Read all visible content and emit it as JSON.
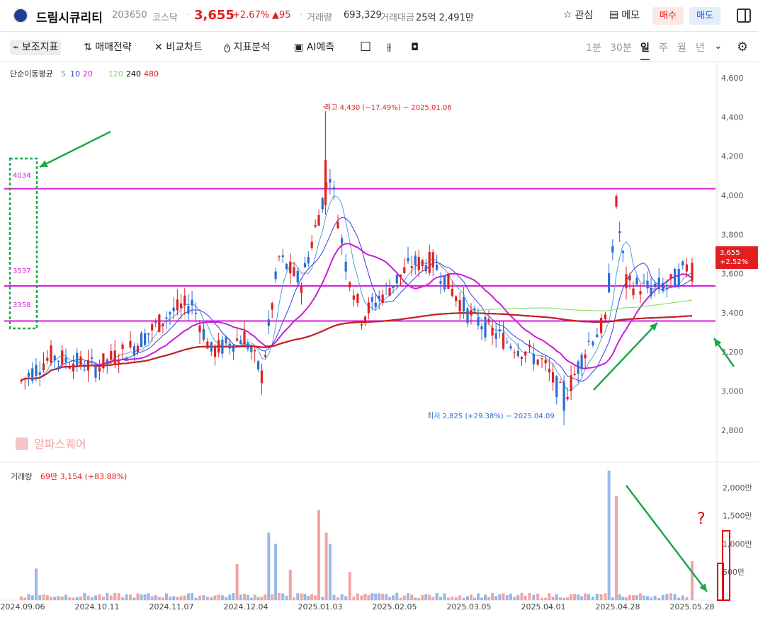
{
  "header": {
    "name": "드림시큐리티",
    "code": "203650",
    "market": "코스닥",
    "price": "3,655",
    "change_pct": "+2.67%",
    "change_abs": "▲95",
    "volume_label": "거래량",
    "volume_value": "693,329",
    "amount_label": "거래대금",
    "amount_value": "25억 2,491만",
    "watch_label": "관심",
    "memo_label": "메모",
    "buy_label": "매수",
    "sell_label": "매도"
  },
  "toolbar": {
    "indicator": "보조지표",
    "strategy": "매매전략",
    "compare": "비교차트",
    "analysis": "지표분석",
    "ai": "AI예측",
    "timeframes": [
      "1분",
      "30분",
      "일",
      "주",
      "월",
      "년"
    ],
    "selected_timeframe": "일"
  },
  "legend": {
    "ma_label": "단순이동평균",
    "ma_periods": [
      "5",
      "10",
      "20",
      "120",
      "240",
      "480"
    ],
    "ma_colors": [
      "#5b9bd5",
      "#3b3bd6",
      "#c81ed8",
      "#7ed957",
      "#000000",
      "#d01e1e"
    ]
  },
  "watermark": "알파스퀘어",
  "annotations": {
    "high": "최고 4,430 (−17.49%) − 2025.01.06",
    "low": "최저 2,825 (+29.38%) − 2025.04.09",
    "level_labels": [
      "4034",
      "3537",
      "3358"
    ],
    "price_tag_value": "3,655",
    "price_tag_change": "+2.52%",
    "volume_legend_label": "거래량",
    "volume_legend_value": "69만 3,154 (+83.88%)",
    "volume_red_mark": "?"
  },
  "colors": {
    "up": "#e02020",
    "down": "#2b6cd4",
    "vol_up": "#f4a3a3",
    "vol_down": "#97b8ea",
    "level_line": "#d91ed9",
    "green_annotation": "#1aa84a"
  },
  "chart_data": {
    "type": "candlestick",
    "x_ticks": [
      "2024.09.06",
      "2024.10.11",
      "2024.11.07",
      "2024.12.04",
      "2025.01.03",
      "2025.02.05",
      "2025.03.05",
      "2025.04.01",
      "2025.04.28",
      "2025.05.28"
    ],
    "price_axis_ticks": [
      2800,
      3000,
      3200,
      3400,
      3600,
      3800,
      4000,
      4200,
      4400,
      4600
    ],
    "price_range": [
      2640,
      4680
    ],
    "volume_axis_ticks": [
      "500만",
      "1,000만",
      "1,500만",
      "2,000만"
    ],
    "volume_axis_values": [
      500,
      1000,
      1500,
      2000
    ],
    "volume_range": [
      0,
      2300
    ],
    "horizontal_levels": [
      4034,
      3537,
      3358
    ],
    "high": {
      "value": 4430,
      "date": "2025.01.06"
    },
    "low": {
      "value": 2825,
      "date": "2025.04.09"
    },
    "last_price": 3655,
    "anchors": [
      [
        "2024.09.06",
        3050
      ],
      [
        "2024.09.20",
        3180
      ],
      [
        "2024.10.11",
        3120
      ],
      [
        "2024.10.25",
        3230
      ],
      [
        "2024.11.07",
        3400
      ],
      [
        "2024.11.15",
        3450
      ],
      [
        "2024.11.22",
        3200
      ],
      [
        "2024.12.04",
        3280
      ],
      [
        "2024.12.11",
        3080
      ],
      [
        "2024.12.18",
        3680
      ],
      [
        "2024.12.27",
        3550
      ],
      [
        "2025.01.03",
        3900
      ],
      [
        "2025.01.08",
        4120
      ],
      [
        "2025.01.15",
        3650
      ],
      [
        "2025.01.22",
        3380
      ],
      [
        "2025.02.05",
        3550
      ],
      [
        "2025.02.12",
        3650
      ],
      [
        "2025.02.20",
        3660
      ],
      [
        "2025.03.05",
        3400
      ],
      [
        "2025.03.14",
        3300
      ],
      [
        "2025.03.26",
        3200
      ],
      [
        "2025.04.01",
        3150
      ],
      [
        "2025.04.09",
        2960
      ],
      [
        "2025.04.18",
        3250
      ],
      [
        "2025.04.24",
        3350
      ],
      [
        "2025.04.28",
        3950
      ],
      [
        "2025.05.02",
        3550
      ],
      [
        "2025.05.12",
        3520
      ],
      [
        "2025.05.20",
        3550
      ],
      [
        "2025.05.28",
        3655
      ]
    ],
    "volume_spikes": [
      {
        "date": "2024.09.13",
        "value": 560
      },
      {
        "date": "2024.12.02",
        "value": 640
      },
      {
        "date": "2024.12.13",
        "value": 1200
      },
      {
        "date": "2024.12.16",
        "value": 1000
      },
      {
        "date": "2024.12.23",
        "value": 540
      },
      {
        "date": "2025.01.03",
        "value": 1600
      },
      {
        "date": "2025.01.06",
        "value": 1200
      },
      {
        "date": "2025.01.08",
        "value": 1000
      },
      {
        "date": "2025.01.17",
        "value": 500
      },
      {
        "date": "2025.04.25",
        "value": 2300
      },
      {
        "date": "2025.04.28",
        "value": 1850
      },
      {
        "date": "2025.05.28",
        "value": 693
      }
    ]
  }
}
